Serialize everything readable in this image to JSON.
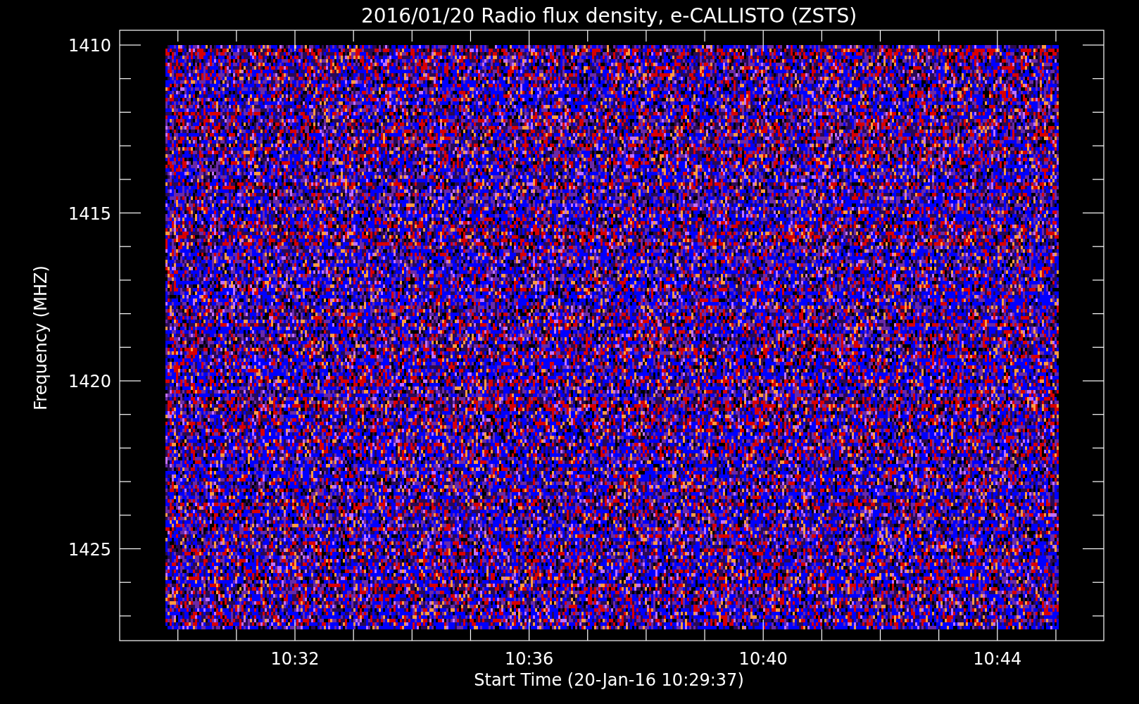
{
  "title": "2016/01/20  Radio flux density, e-CALLISTO (ZSTS)",
  "y_axis": {
    "label": "Frequency (MHZ)",
    "ticks": [
      "1410",
      "1415",
      "1420",
      "1425"
    ]
  },
  "x_axis": {
    "label": "Start Time (20-Jan-16 10:29:37)",
    "ticks": [
      "10:32",
      "10:36",
      "10:40",
      "10:44"
    ]
  }
}
